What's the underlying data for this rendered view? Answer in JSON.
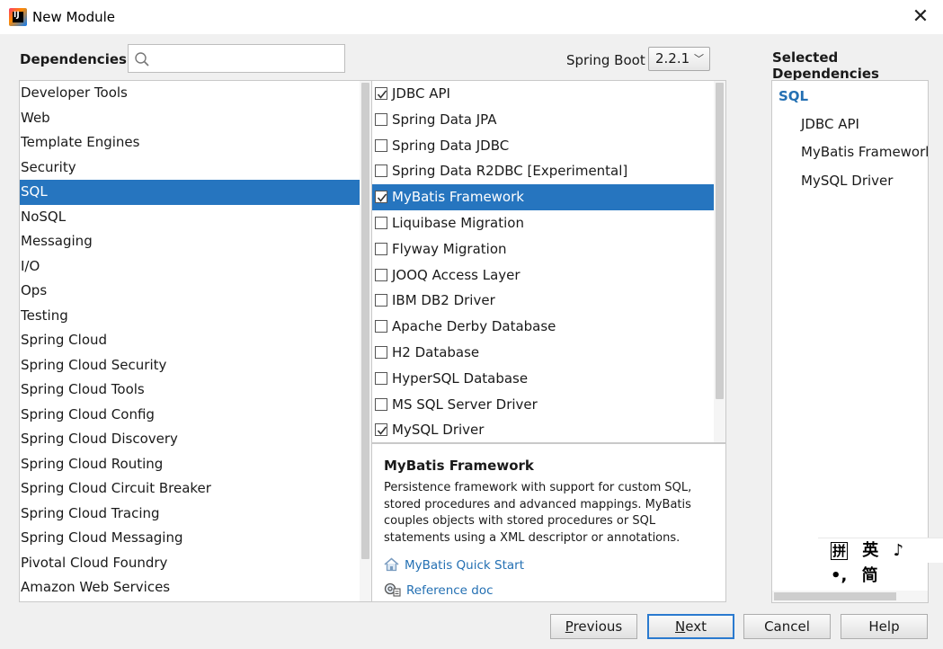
{
  "window": {
    "title": "New Module",
    "app_icon_text": "IJ"
  },
  "toolbar": {
    "dependencies_label": "Dependencies",
    "search_placeholder": "",
    "spring_boot_label": "Spring Boot",
    "spring_boot_version": "2.2.1"
  },
  "categories": [
    {
      "label": "Developer Tools",
      "selected": false
    },
    {
      "label": "Web",
      "selected": false
    },
    {
      "label": "Template Engines",
      "selected": false
    },
    {
      "label": "Security",
      "selected": false
    },
    {
      "label": "SQL",
      "selected": true
    },
    {
      "label": "NoSQL",
      "selected": false
    },
    {
      "label": "Messaging",
      "selected": false
    },
    {
      "label": "I/O",
      "selected": false
    },
    {
      "label": "Ops",
      "selected": false
    },
    {
      "label": "Testing",
      "selected": false
    },
    {
      "label": "Spring Cloud",
      "selected": false
    },
    {
      "label": "Spring Cloud Security",
      "selected": false
    },
    {
      "label": "Spring Cloud Tools",
      "selected": false
    },
    {
      "label": "Spring Cloud Config",
      "selected": false
    },
    {
      "label": "Spring Cloud Discovery",
      "selected": false
    },
    {
      "label": "Spring Cloud Routing",
      "selected": false
    },
    {
      "label": "Spring Cloud Circuit Breaker",
      "selected": false
    },
    {
      "label": "Spring Cloud Tracing",
      "selected": false
    },
    {
      "label": "Spring Cloud Messaging",
      "selected": false
    },
    {
      "label": "Pivotal Cloud Foundry",
      "selected": false
    },
    {
      "label": "Amazon Web Services",
      "selected": false
    }
  ],
  "dependencies": [
    {
      "label": "JDBC API",
      "checked": true,
      "selected": false
    },
    {
      "label": "Spring Data JPA",
      "checked": false,
      "selected": false
    },
    {
      "label": "Spring Data JDBC",
      "checked": false,
      "selected": false
    },
    {
      "label": "Spring Data R2DBC [Experimental]",
      "checked": false,
      "selected": false
    },
    {
      "label": "MyBatis Framework",
      "checked": true,
      "selected": true
    },
    {
      "label": "Liquibase Migration",
      "checked": false,
      "selected": false
    },
    {
      "label": "Flyway Migration",
      "checked": false,
      "selected": false
    },
    {
      "label": "JOOQ Access Layer",
      "checked": false,
      "selected": false
    },
    {
      "label": "IBM DB2 Driver",
      "checked": false,
      "selected": false
    },
    {
      "label": "Apache Derby Database",
      "checked": false,
      "selected": false
    },
    {
      "label": "H2 Database",
      "checked": false,
      "selected": false
    },
    {
      "label": "HyperSQL Database",
      "checked": false,
      "selected": false
    },
    {
      "label": "MS SQL Server Driver",
      "checked": false,
      "selected": false
    },
    {
      "label": "MySQL Driver",
      "checked": true,
      "selected": false
    }
  ],
  "description": {
    "title": "MyBatis Framework",
    "lines": [
      "Persistence framework with support for custom SQL,",
      "stored procedures and advanced mappings. MyBatis",
      "couples objects with stored procedures or SQL",
      "statements using a XML descriptor or annotations."
    ],
    "links": [
      {
        "label": "MyBatis Quick Start",
        "icon": "home-icon"
      },
      {
        "label": "Reference doc",
        "icon": "reference-doc-icon"
      }
    ]
  },
  "selected_panel": {
    "title": "Selected Dependencies",
    "group": "SQL",
    "items": [
      "JDBC API",
      "MyBatis Framework",
      "MySQL Driver"
    ]
  },
  "ime": {
    "items": [
      "拼",
      "英",
      "♪",
      "•,",
      "简"
    ]
  },
  "buttons": {
    "previous": {
      "mnemonic": "P",
      "rest": "revious"
    },
    "next": {
      "mnemonic": "N",
      "rest": "ext"
    },
    "cancel": "Cancel",
    "help": "Help"
  },
  "colors": {
    "selection": "#2675bf",
    "link": "#2470b3",
    "default_button_border": "#2a7acf"
  }
}
